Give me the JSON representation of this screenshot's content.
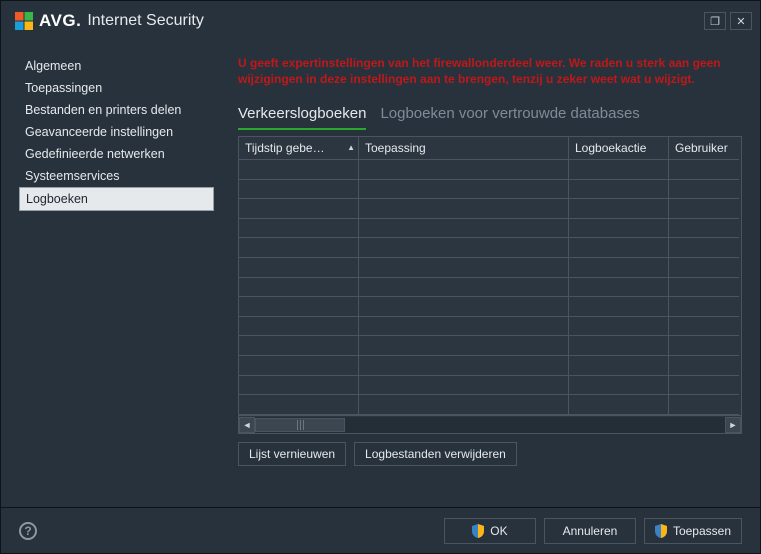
{
  "app": {
    "brand_text": "AVG",
    "brand_text_dot": ".",
    "title": "Internet Security"
  },
  "title_controls": {
    "restore": "❐",
    "close": "✕"
  },
  "sidebar": {
    "items": [
      {
        "label": "Algemeen"
      },
      {
        "label": "Toepassingen"
      },
      {
        "label": "Bestanden en printers delen"
      },
      {
        "label": "Geavanceerde instellingen"
      },
      {
        "label": "Gedefinieerde netwerken"
      },
      {
        "label": "Systeemservices"
      },
      {
        "label": "Logboeken",
        "active": true
      }
    ]
  },
  "main": {
    "warning": "U geeft expertinstellingen van het firewallonderdeel weer. We raden u sterk aan geen wijzigingen in deze instellingen aan te brengen, tenzij u zeker weet wat u wijzigt.",
    "tabs": [
      {
        "label": "Verkeerslogboeken",
        "active": true
      },
      {
        "label": "Logboeken voor vertrouwde  databases"
      }
    ],
    "columns": [
      {
        "label": "Tijdstip gebe…",
        "sorted": true
      },
      {
        "label": "Toepassing"
      },
      {
        "label": "Logboekactie"
      },
      {
        "label": "Gebruiker"
      }
    ],
    "buttons": {
      "refresh": "Lijst vernieuwen",
      "delete": "Logbestanden verwijderen"
    }
  },
  "footer": {
    "ok": "OK",
    "cancel": "Annuleren",
    "apply": "Toepassen",
    "help": "?"
  }
}
